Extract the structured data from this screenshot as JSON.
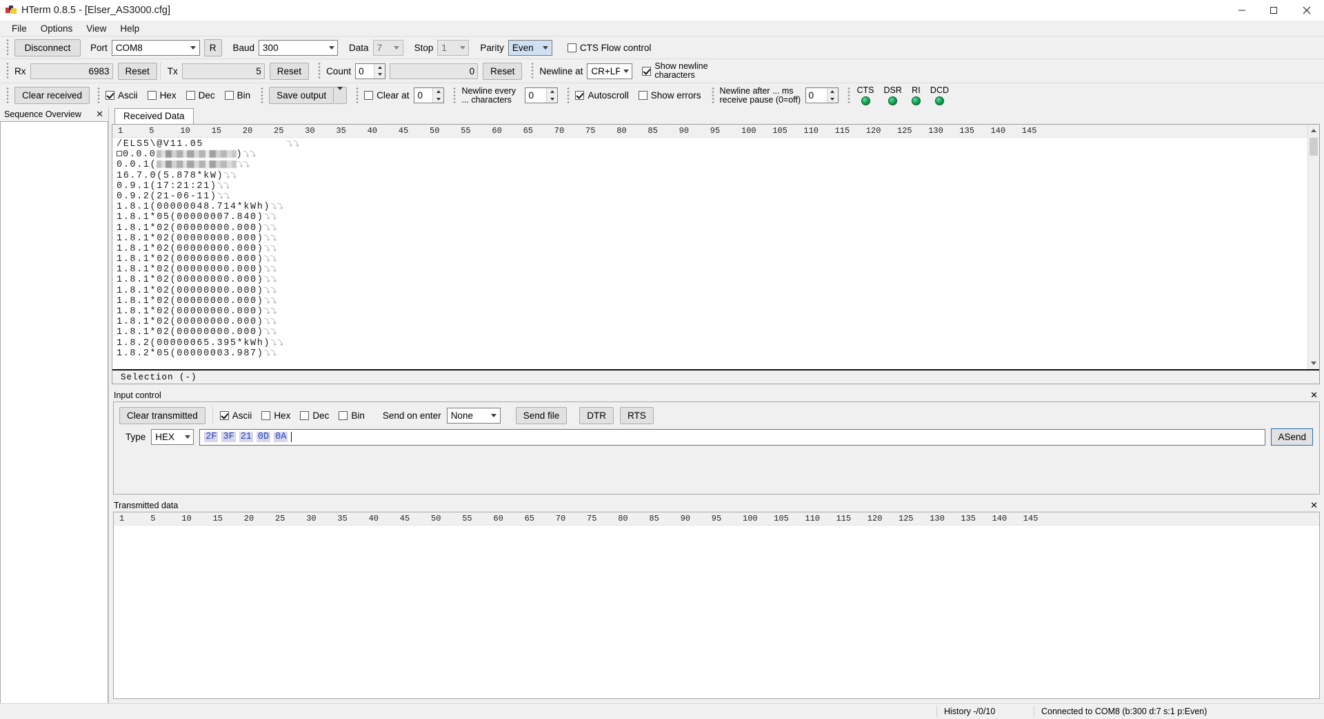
{
  "window": {
    "title": "HTerm 0.8.5 - [Elser_AS3000.cfg]",
    "minimize": "—",
    "maximize": "❐",
    "close": "✕"
  },
  "menu": [
    "File",
    "Options",
    "View",
    "Help"
  ],
  "connection": {
    "disconnect_label": "Disconnect",
    "port_label": "Port",
    "port_value": "COM8",
    "rescan_label": "R",
    "baud_label": "Baud",
    "baud_value": "300",
    "data_label": "Data",
    "data_value": "7",
    "stop_label": "Stop",
    "stop_value": "1",
    "parity_label": "Parity",
    "parity_value": "Even",
    "cts_flow_label": "CTS Flow control",
    "cts_flow_checked": false
  },
  "counters": {
    "rx_label": "Rx",
    "rx_value": "6983",
    "rx_reset": "Reset",
    "tx_label": "Tx",
    "tx_value": "5",
    "tx_reset": "Reset",
    "count_label": "Count",
    "count_value": "0",
    "count_total": "0",
    "count_reset": "Reset",
    "newline_at_label": "Newline at",
    "newline_at_value": "CR+LF",
    "show_newline_label": "Show newline characters",
    "show_newline_checked": true
  },
  "received_toolbar": {
    "clear_received": "Clear received",
    "formats": [
      {
        "label": "Ascii",
        "checked": true
      },
      {
        "label": "Hex",
        "checked": false
      },
      {
        "label": "Dec",
        "checked": false
      },
      {
        "label": "Bin",
        "checked": false
      }
    ],
    "save_output": "Save output",
    "clear_at_label": "Clear at",
    "clear_at_checked": false,
    "clear_at_value": "0",
    "newline_every_label": "Newline every ... characters",
    "newline_every_value": "0",
    "autoscroll_label": "Autoscroll",
    "autoscroll_checked": true,
    "show_errors_label": "Show errors",
    "show_errors_checked": false,
    "newline_after_label": "Newline after ... ms receive pause (0=off)",
    "newline_after_value": "0",
    "leds": [
      "CTS",
      "DSR",
      "RI",
      "DCD"
    ]
  },
  "sequence_panel": {
    "title": "Sequence Overview",
    "close": "✕"
  },
  "received": {
    "tab_label": "Received Data",
    "ruler": [
      "1",
      "5",
      "10",
      "15",
      "20",
      "25",
      "30",
      "35",
      "40",
      "45",
      "50",
      "55",
      "60",
      "65",
      "70",
      "75",
      "80",
      "85",
      "90",
      "95",
      "100",
      "105",
      "110",
      "115",
      "120",
      "125",
      "130",
      "135",
      "140",
      "145"
    ],
    "selection_label": "Selection (-)",
    "lines": [
      {
        "text": "/ELS5\\@V11.05",
        "newline_gap": true
      },
      {
        "prefix_square": true,
        "text": "0.0.0",
        "redacted": true,
        "suffix": ")"
      },
      {
        "text": "0.0.1(",
        "redacted": true
      },
      {
        "text": "16.7.0(5.878*kW)"
      },
      {
        "text": "0.9.1(17:21:21)"
      },
      {
        "text": "0.9.2(21-06-11)"
      },
      {
        "text": "1.8.1(00000048.714*kWh)"
      },
      {
        "text": "1.8.1*05(00000007.840)"
      },
      {
        "text": "1.8.1*02(00000000.000)"
      },
      {
        "text": "1.8.1*02(00000000.000)"
      },
      {
        "text": "1.8.1*02(00000000.000)"
      },
      {
        "text": "1.8.1*02(00000000.000)"
      },
      {
        "text": "1.8.1*02(00000000.000)"
      },
      {
        "text": "1.8.1*02(00000000.000)"
      },
      {
        "text": "1.8.1*02(00000000.000)"
      },
      {
        "text": "1.8.1*02(00000000.000)"
      },
      {
        "text": "1.8.1*02(00000000.000)"
      },
      {
        "text": "1.8.1*02(00000000.000)"
      },
      {
        "text": "1.8.1*02(00000000.000)"
      },
      {
        "text": "1.8.2(00000065.395*kWh)"
      },
      {
        "text": "1.8.2*05(00000003.987)"
      }
    ],
    "newline_glyph": "⤵⤵"
  },
  "input_control": {
    "title": "Input control",
    "close": "✕",
    "clear_transmitted": "Clear transmitted",
    "formats": [
      {
        "label": "Ascii",
        "checked": true
      },
      {
        "label": "Hex",
        "checked": false
      },
      {
        "label": "Dec",
        "checked": false
      },
      {
        "label": "Bin",
        "checked": false
      }
    ],
    "send_on_enter_label": "Send on enter",
    "send_on_enter_value": "None",
    "send_file": "Send file",
    "dtr": "DTR",
    "rts": "RTS",
    "type_label": "Type",
    "type_value": "HEX",
    "input_bytes": [
      "2F",
      "3F",
      "21",
      "0D",
      "0A"
    ],
    "send_button": "ASend"
  },
  "transmitted": {
    "title": "Transmitted data",
    "close": "✕",
    "ruler": [
      "1",
      "5",
      "10",
      "15",
      "20",
      "25",
      "30",
      "35",
      "40",
      "45",
      "50",
      "55",
      "60",
      "65",
      "70",
      "75",
      "80",
      "85",
      "90",
      "95",
      "100",
      "105",
      "110",
      "115",
      "120",
      "125",
      "130",
      "135",
      "140",
      "145"
    ]
  },
  "status": {
    "history": "History -/0/10",
    "connection": "Connected to COM8 (b:300 d:7 s:1 p:Even)"
  },
  "colors": {
    "accent": "#2440c8",
    "led_green": "#15a75a",
    "selected_combo": "#cfe0f2"
  }
}
